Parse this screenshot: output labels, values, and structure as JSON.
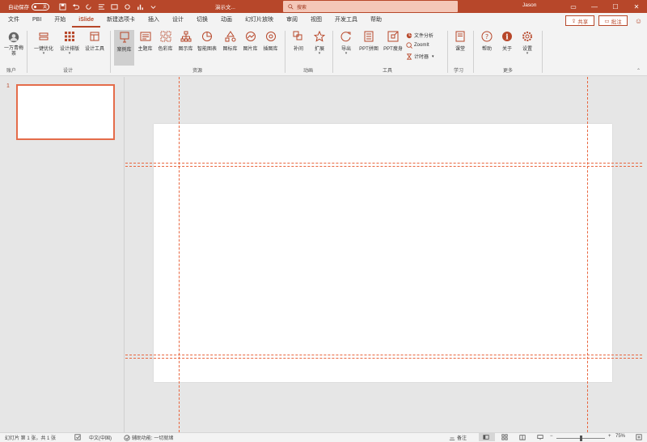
{
  "titlebar": {
    "autosave_label": "自动保存",
    "autosave_state": "关",
    "doc_title": "演示文...",
    "search_placeholder": "搜索",
    "username": "Jason",
    "buttons": [
      "ribbon-display-icon",
      "minimize-icon",
      "maximize-icon",
      "close-icon"
    ]
  },
  "menu": {
    "tabs": [
      "文件",
      "PBI",
      "开始",
      "iSlide",
      "新建选项卡",
      "插入",
      "设计",
      "切换",
      "动画",
      "幻灯片放映",
      "审阅",
      "视图",
      "开发工具",
      "帮助"
    ],
    "active_index": 3,
    "share_label": "共享",
    "comment_label": "批注"
  },
  "ribbon": {
    "account": {
      "label": "一万青梅茶",
      "group": "账户"
    },
    "design": {
      "items": [
        "一键优化",
        "设计排版",
        "设计工具"
      ],
      "group": "设计"
    },
    "resources": {
      "items": [
        "案例库",
        "主题库",
        "色彩库",
        "图示库",
        "智能图表",
        "图标库",
        "图片库",
        "插图库"
      ],
      "group": "资源"
    },
    "animation": {
      "items": [
        "补间",
        "扩展"
      ],
      "group": "动画"
    },
    "tools": {
      "items": [
        "导出",
        "PPT拼图",
        "PPT瘦身"
      ],
      "small": [
        "文件分析",
        "ZoomIt",
        "计时器"
      ],
      "group": "工具"
    },
    "learn": {
      "items": [
        "课堂"
      ],
      "group": "学习"
    },
    "more": {
      "items": [
        "帮助",
        "关于",
        "设置"
      ],
      "group": "更多"
    }
  },
  "thumbnails": {
    "slide_number": "1"
  },
  "statusbar": {
    "slide_info": "幻灯片 第 1 张，共 1 张",
    "language": "中文(中国)",
    "accessibility": "辅助功能: 一切就绪",
    "notes": "备注",
    "zoom": "75%",
    "zoom_fraction": 0.5
  },
  "colors": {
    "accent": "#b7472a",
    "guide": "#e8663f",
    "selection": "#e46c4a"
  }
}
